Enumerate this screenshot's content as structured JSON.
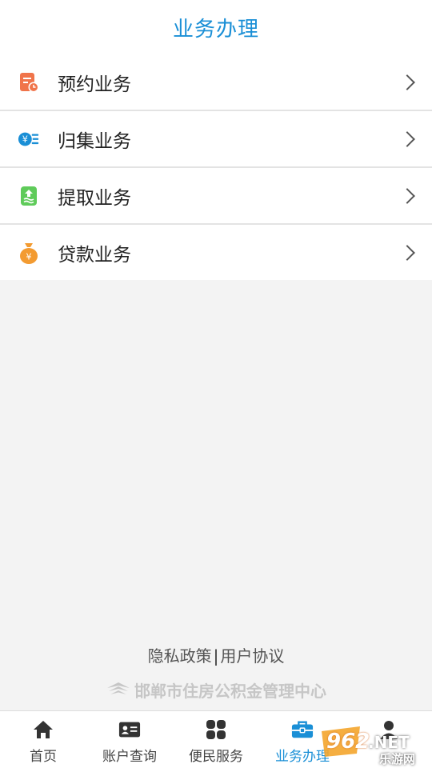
{
  "header": {
    "title": "业务办理"
  },
  "menu": {
    "items": [
      {
        "label": "预约业务",
        "icon": "calendar-clock-icon",
        "color": "#f0744a"
      },
      {
        "label": "归集业务",
        "icon": "yuan-coins-icon",
        "color": "#1a8fd6"
      },
      {
        "label": "提取业务",
        "icon": "withdraw-up-arrow-icon",
        "color": "#5fcb5a"
      },
      {
        "label": "贷款业务",
        "icon": "money-bag-icon",
        "color": "#f39b31"
      }
    ]
  },
  "footer": {
    "privacy": "隐私政策",
    "separator": "|",
    "agreement": "用户协议",
    "org_name": "邯郸市住房公积金管理中心"
  },
  "tabbar": {
    "tabs": [
      {
        "label": "首页",
        "icon": "home-icon",
        "active": false
      },
      {
        "label": "账户查询",
        "icon": "id-card-icon",
        "active": false
      },
      {
        "label": "便民服务",
        "icon": "grid-apps-icon",
        "active": false
      },
      {
        "label": "业务办理",
        "icon": "briefcase-icon",
        "active": true
      },
      {
        "label": "",
        "icon": "user-icon",
        "active": false
      }
    ]
  },
  "watermark": {
    "number": "962",
    "domain": ".NET",
    "site": "乐游网"
  },
  "colors": {
    "accent": "#1a8fd6",
    "background": "#f3f3f3"
  }
}
